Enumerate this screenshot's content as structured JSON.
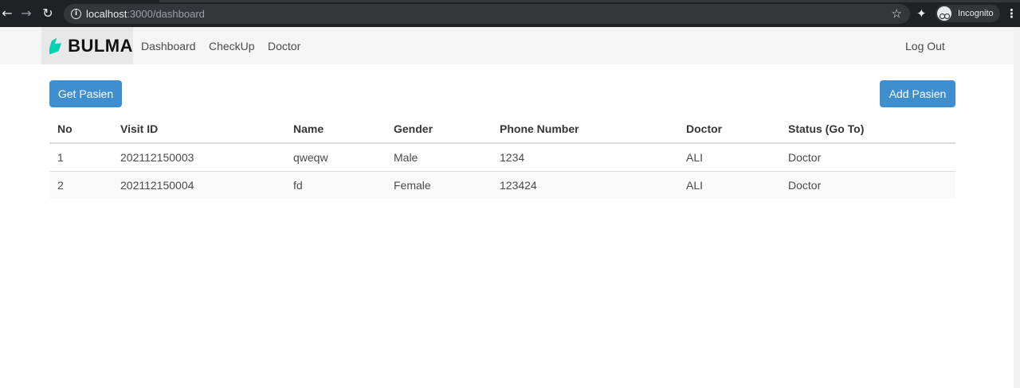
{
  "browser": {
    "url_host": "localhost",
    "url_path": ":3000/dashboard",
    "incognito_label": "Incognito"
  },
  "navbar": {
    "brand": "BULMA",
    "brand_color": "#00d1b2",
    "items": [
      {
        "label": "Dashboard"
      },
      {
        "label": "CheckUp"
      },
      {
        "label": "Doctor"
      }
    ],
    "logout": "Log Out"
  },
  "actions": {
    "get_label": "Get Pasien",
    "add_label": "Add Pasien",
    "button_color": "#3e8ed0"
  },
  "table": {
    "headers": [
      "No",
      "Visit ID",
      "Name",
      "Gender",
      "Phone Number",
      "Doctor",
      "Status (Go To)"
    ],
    "rows": [
      [
        "1",
        "202112150003",
        "qweqw",
        "Male",
        "1234",
        "ALI",
        "Doctor"
      ],
      [
        "2",
        "202112150004",
        "fd",
        "Female",
        "123424",
        "ALI",
        "Doctor"
      ]
    ]
  }
}
